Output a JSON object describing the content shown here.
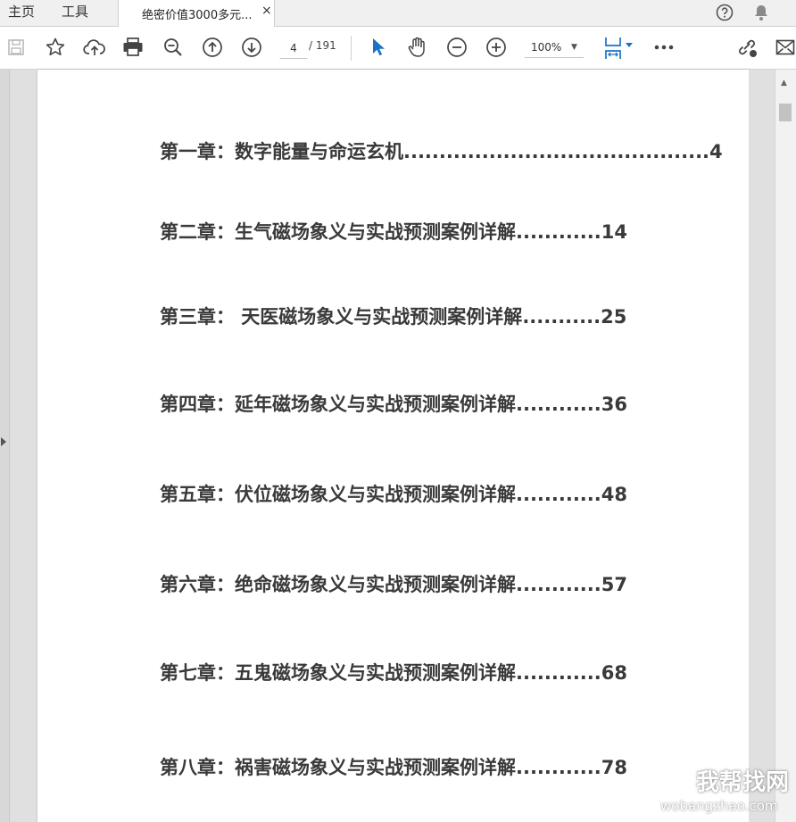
{
  "nav": {
    "home": "主页",
    "tools": "工具"
  },
  "doc_tab": {
    "title": "绝密价值3000多元...",
    "close": "×"
  },
  "toolbar": {
    "page_current": "4",
    "page_total": "/ 191",
    "zoom": "100%"
  },
  "toc": [
    {
      "text": "第一章：数字能量与命运玄机",
      "dots": "...........................................",
      "page": "4"
    },
    {
      "text": "第二章：生气磁场象义与实战预测案例详解",
      "dots": "............",
      "page": "14"
    },
    {
      "text": "第三章：  天医磁场象义与实战预测案例详解",
      "dots": "...........",
      "page": "25"
    },
    {
      "text": "第四章：延年磁场象义与实战预测案例详解",
      "dots": "............",
      "page": "36"
    },
    {
      "text": "第五章：伏位磁场象义与实战预测案例详解",
      "dots": "............",
      "page": "48"
    },
    {
      "text": "第六章：绝命磁场象义与实战预测案例详解",
      "dots": "............",
      "page": "57"
    },
    {
      "text": "第七章：五鬼磁场象义与实战预测案例详解",
      "dots": "............",
      "page": "68"
    },
    {
      "text": "第八章：祸害磁场象义与实战预测案例详解",
      "dots": "............",
      "page": "78"
    }
  ],
  "watermark": {
    "text": "我帮找网",
    "url": "wobangzhao.com"
  },
  "colors": {
    "accent_blue": "#1a73c8",
    "toolbar_bg": "#ffffff",
    "tab_bg": "#f0f0f0"
  }
}
